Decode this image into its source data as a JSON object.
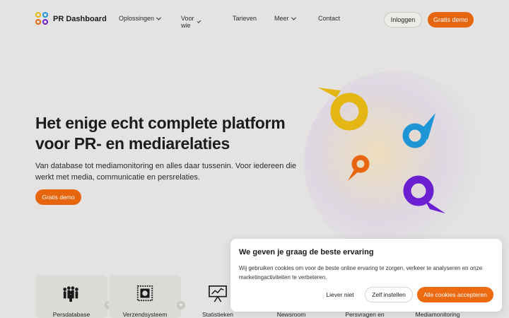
{
  "brand": {
    "name": "PR Dashboard"
  },
  "nav": {
    "items": [
      {
        "label": "Oplossingen",
        "dropdown": true
      },
      {
        "label": "Voor wie",
        "dropdown": true
      },
      {
        "label": "Tarieven",
        "dropdown": false
      },
      {
        "label": "Meer",
        "dropdown": true
      },
      {
        "label": "Contact",
        "dropdown": false
      }
    ],
    "login_label": "Inloggen",
    "demo_label": "Gratis demo"
  },
  "hero": {
    "title": "Het enige echt complete platform voor PR- en mediarelaties",
    "subtitle": "Van database tot mediamonitoring en alles daar tussenin. Voor iedereen die werkt met media, communicatie en persrelaties.",
    "cta_label": "Gratis demo"
  },
  "features": [
    {
      "label": "Persdatabase",
      "icon": "people-group-icon"
    },
    {
      "label": "Verzendsysteem",
      "icon": "stamp-icon"
    },
    {
      "label": "Statistieken",
      "icon": "presentation-chart-icon"
    },
    {
      "label": "Newsroom",
      "icon": "newsroom-icon"
    },
    {
      "label": "Persvragen en",
      "icon": "questions-icon"
    },
    {
      "label": "Mediamonitoring",
      "icon": "monitoring-icon"
    }
  ],
  "cookie": {
    "title": "We geven je graag de beste ervaring",
    "text": "Wij gebruiken cookies om voor de beste online ervaring te zorgen, verkeer te analyseren en onze marketingactiviteiten te verbeteren.",
    "reject_label": "Liever niet",
    "settings_label": "Zelf instellen",
    "accept_label": "Alle cookies accepteren"
  },
  "colors": {
    "accent": "#e6650f",
    "background": "#e4e3e1",
    "shape_yellow": "#e3b613",
    "shape_blue": "#1e96d6",
    "shape_orange": "#e8650f",
    "shape_purple": "#6b1fd1"
  }
}
